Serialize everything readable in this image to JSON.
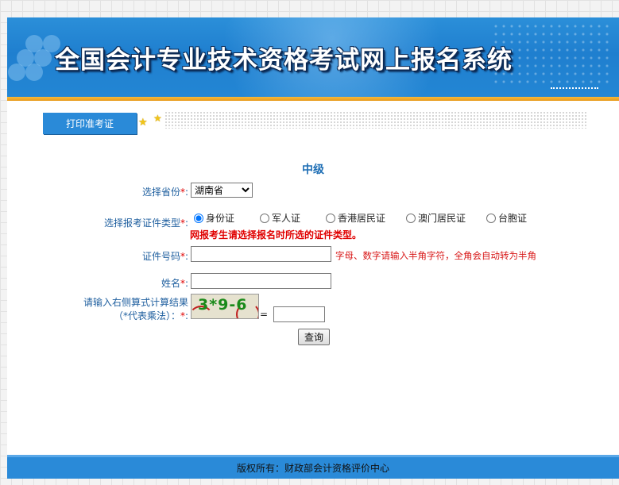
{
  "header": {
    "title": "全国会计专业技术资格考试网上报名系统"
  },
  "tabs": [
    {
      "label": "打印准考证"
    }
  ],
  "form": {
    "level_title": "中级",
    "province": {
      "label": "选择省份",
      "required_mark": "*",
      "colon": ":",
      "selected": "湖南省"
    },
    "id_type": {
      "label": "选择报考证件类型",
      "required_mark": "*",
      "colon": ":",
      "options": [
        {
          "label": "身份证",
          "checked": true
        },
        {
          "label": "军人证",
          "checked": false
        },
        {
          "label": "香港居民证",
          "checked": false
        },
        {
          "label": "澳门居民证",
          "checked": false
        },
        {
          "label": "台胞证",
          "checked": false
        }
      ],
      "warning": "网报考生请选择报名时所选的证件类型。"
    },
    "id_number": {
      "label": "证件号码",
      "required_mark": "*",
      "colon": ":",
      "value": "",
      "hint": "字母、数字请输入半角字符，全角会自动转为半角"
    },
    "name": {
      "label": "姓名",
      "required_mark": "*",
      "colon": ":",
      "value": ""
    },
    "captcha": {
      "label_line1": "请输入右侧算式计算结果",
      "label_line2": "（*代表乘法）：",
      "required_mark": "*",
      "colon": ":",
      "code": "3*9-6",
      "equals": "=",
      "value": ""
    },
    "submit_label": "查询"
  },
  "footer": {
    "text": "版权所有：财政部会计资格评价中心"
  },
  "colors": {
    "banner": "#2a8ad8",
    "accent_orange": "#f6b93a",
    "label_blue": "#1f5f9f",
    "required_red": "#e00000"
  }
}
